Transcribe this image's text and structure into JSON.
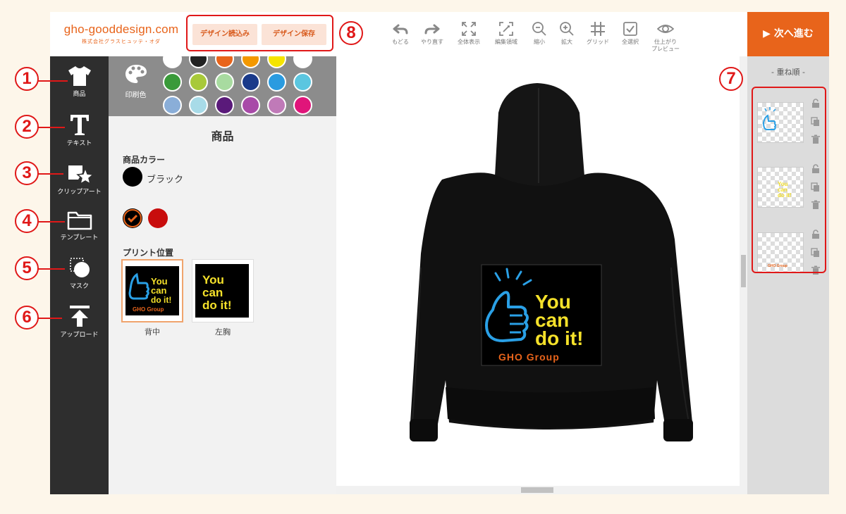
{
  "header": {
    "logo_main": "gho-gooddesign.com",
    "logo_sub": "株式会社グラスヒュッテ・オダ",
    "load_label": "デザイン読込み",
    "save_label": "デザイン保存",
    "next_label": "▶ 次へ進む",
    "tools": [
      {
        "label": "もどる",
        "icon": "undo-icon"
      },
      {
        "label": "やり直す",
        "icon": "redo-icon"
      },
      {
        "label": "全体表示",
        "icon": "fit-screen-icon"
      },
      {
        "label": "編集領域",
        "icon": "edit-area-icon"
      },
      {
        "label": "縮小",
        "icon": "zoom-out-icon"
      },
      {
        "label": "拡大",
        "icon": "zoom-in-icon"
      },
      {
        "label": "グリッド",
        "icon": "grid-icon"
      },
      {
        "label": "全選択",
        "icon": "select-all-icon"
      },
      {
        "label": "仕上がり",
        "label2": "プレビュー",
        "icon": "eye-icon"
      }
    ]
  },
  "leftnav": {
    "items": [
      {
        "label": "商品",
        "icon": "tshirt-icon"
      },
      {
        "label": "テキスト",
        "icon": "text-icon"
      },
      {
        "label": "クリップアート",
        "icon": "clipart-icon"
      },
      {
        "label": "テンプレート",
        "icon": "folder-icon"
      },
      {
        "label": "マスク",
        "icon": "mask-icon"
      },
      {
        "label": "アップロード",
        "icon": "upload-icon"
      }
    ]
  },
  "panel": {
    "print_color_label": "印刷色",
    "palette_colors": [
      "#ffffff",
      "#222222",
      "#e8641b",
      "#f39800",
      "#f5e400",
      "#ffffff",
      "#3a9a3a",
      "#a8c93a",
      "#a8dba0",
      "#1a3a8a",
      "#2a9be0",
      "#5bc6e0",
      "#8aaed8",
      "#a8dbe8",
      "#5a1a7a",
      "#a84aa8",
      "#c07ab8",
      "#e0157a",
      "#cc1111",
      "#e8a0a0",
      "#f4c0c8",
      "#888888"
    ],
    "title": "商品",
    "product_color_label": "商品カラー",
    "current_color_name": "ブラック",
    "product_colors": [
      "#000000",
      "#000000",
      "#c80d0d"
    ],
    "print_position_label": "プリント位置",
    "positions": [
      {
        "label": "背中",
        "selected": true
      },
      {
        "label": "左胸",
        "selected": false
      }
    ]
  },
  "design": {
    "line1": "You",
    "line2": "can",
    "line3": "do it!",
    "group": "GHO Group",
    "text_color": "#f5e12a",
    "group_color": "#e8641b",
    "thumb_color": "#2aa0e6"
  },
  "layers": {
    "title": "- 重ね順 -",
    "item_count": 3
  },
  "callouts": [
    "1",
    "2",
    "3",
    "4",
    "5",
    "6",
    "7",
    "8"
  ]
}
